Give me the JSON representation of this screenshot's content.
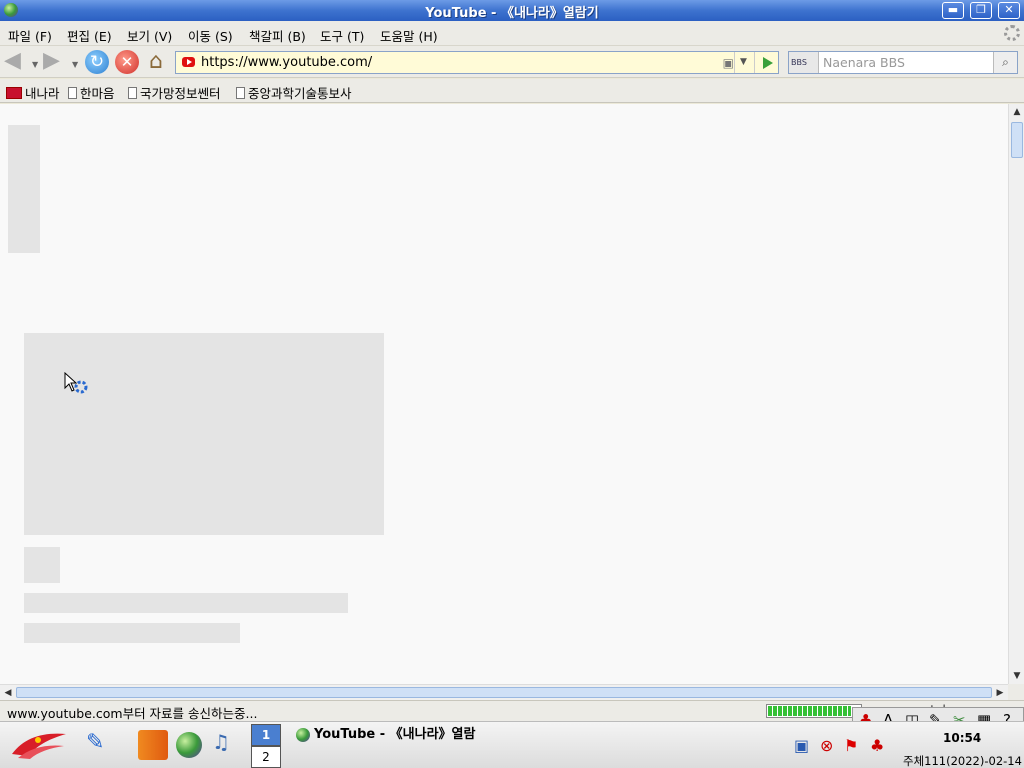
{
  "window": {
    "title": "YouTube - 《내나라》열람기",
    "buttons": {
      "minimize": "▬",
      "maximize": "❐",
      "close": "✕"
    }
  },
  "menu": {
    "items": [
      "파일 (F)",
      "편집 (E)",
      "보기 (V)",
      "이동 (S)",
      "책갈피 (B)",
      "도구 (T)",
      "도움말 (H)"
    ]
  },
  "nav": {
    "url": "https://www.youtube.com/",
    "search_placeholder": "Naenara BBS",
    "search_engine_label": "BBS"
  },
  "bookmarks": {
    "items": [
      "내나라",
      "한마음",
      "국가망정보쎈터",
      "중앙과학기술통보사"
    ]
  },
  "status": {
    "text": "www.youtube.com부터 자료를 송신하는중...",
    "url": "www.youtube.com",
    "progress_percent": 90
  },
  "taskbar": {
    "workspace_1": "1",
    "workspace_2": "2",
    "task_title": "YouTube - 《내나라》열람",
    "clock": "10:54",
    "date": "주체111(2022)-02-14"
  },
  "ime": {
    "items": [
      "A",
      "◫",
      "✎",
      "▦",
      "?"
    ]
  },
  "colors": {
    "titlebar": "#3e73cf",
    "urlbar_bg": "#fffbd7",
    "skeleton": "#e4e4e4",
    "progress": "#35c035"
  }
}
